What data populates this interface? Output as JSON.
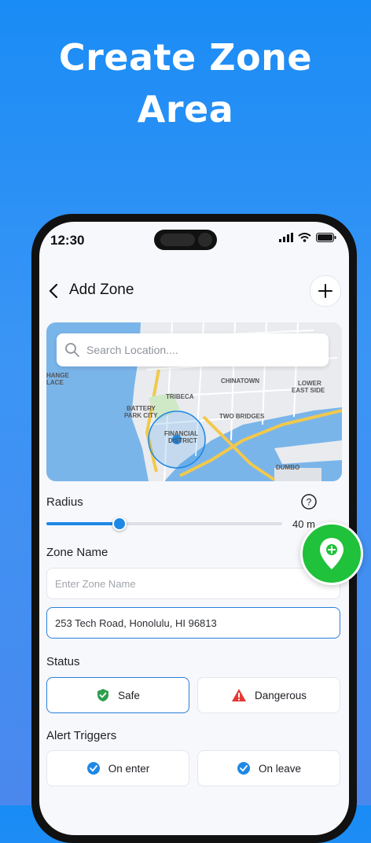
{
  "hero": {
    "line1": "Create Zone",
    "line2": "Area"
  },
  "status_bar": {
    "time": "12:30"
  },
  "header": {
    "title": "Add Zone"
  },
  "map": {
    "search_placeholder": "Search Location....",
    "labels": [
      "TRIBECA",
      "CHINATOWN",
      "LOWER",
      "EAST SIDE",
      "BATTERY",
      "PARK CITY",
      "FINANCIAL",
      "DISTRICT",
      "TWO BRIDGES",
      "DUMBO",
      "HANGE",
      "LACE"
    ]
  },
  "radius": {
    "label": "Radius",
    "value_text": "40 m",
    "fraction": 0.31
  },
  "zone_name": {
    "label": "Zone Name",
    "placeholder": "Enter Zone Name"
  },
  "address": {
    "value": "253 Tech Road, Honolulu, HI 96813"
  },
  "status": {
    "label": "Status",
    "options": [
      {
        "label": "Safe",
        "selected": true
      },
      {
        "label": "Dangerous",
        "selected": false
      }
    ]
  },
  "alerts": {
    "label": "Alert Triggers",
    "options": [
      {
        "label": "On enter",
        "checked": true
      },
      {
        "label": "On leave",
        "checked": true
      }
    ]
  },
  "colors": {
    "accent": "#1e88e5",
    "safe": "#2e9e4f",
    "danger": "#e53935",
    "fab": "#1fc23a"
  }
}
